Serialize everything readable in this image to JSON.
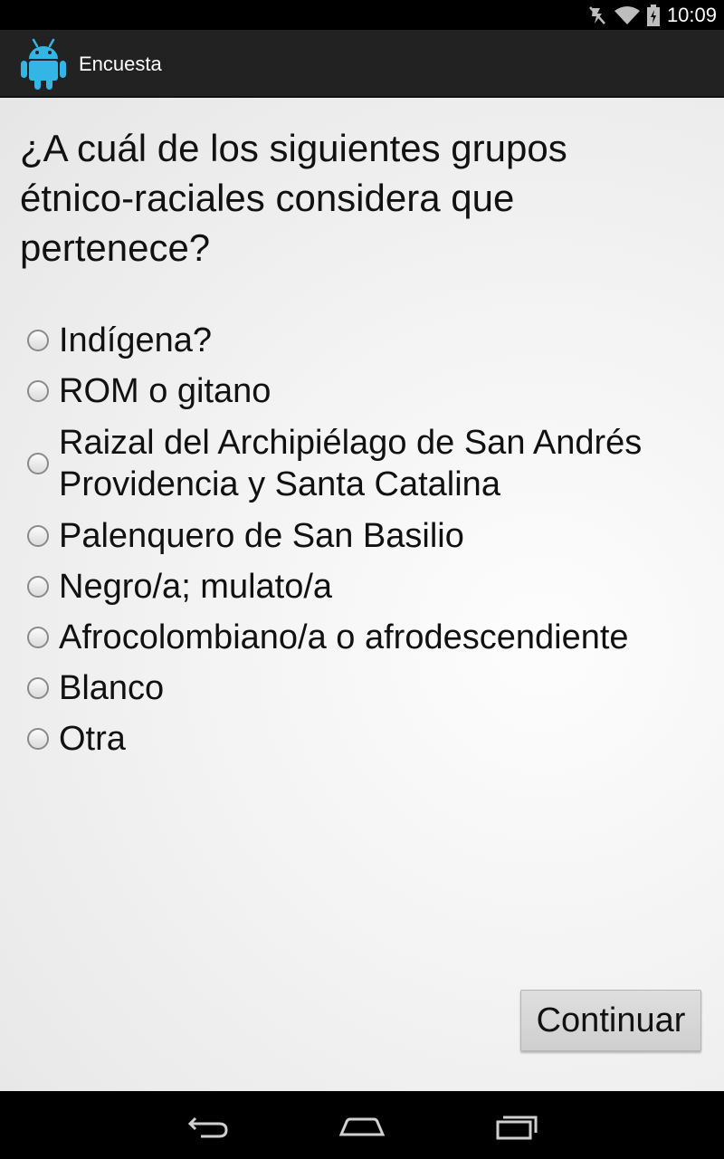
{
  "status_bar": {
    "time": "10:09",
    "icons": [
      "mute-icon",
      "wifi-icon",
      "battery-charging-icon"
    ]
  },
  "action_bar": {
    "app_icon": "android-robot-icon",
    "title": "Encuesta"
  },
  "survey": {
    "question": "¿A cuál de los siguientes grupos étnico-raciales considera que pertenece?",
    "options": [
      {
        "label": "Indígena?",
        "selected": false
      },
      {
        "label": "ROM o gitano",
        "selected": false
      },
      {
        "label": "Raizal del Archipiélago de San Andrés Providencia y Santa Catalina",
        "selected": false
      },
      {
        "label": "Palenquero de San Basilio",
        "selected": false
      },
      {
        "label": "Negro/a; mulato/a",
        "selected": false
      },
      {
        "label": "Afrocolombiano/a o afrodescendiente",
        "selected": false
      },
      {
        "label": "Blanco",
        "selected": false
      },
      {
        "label": "Otra",
        "selected": false
      }
    ],
    "continue_label": "Continuar"
  },
  "nav_bar": {
    "buttons": [
      "back-icon",
      "home-icon",
      "recent-apps-icon"
    ]
  },
  "colors": {
    "accent_android": "#33b5e5",
    "action_bar": "#222222"
  }
}
